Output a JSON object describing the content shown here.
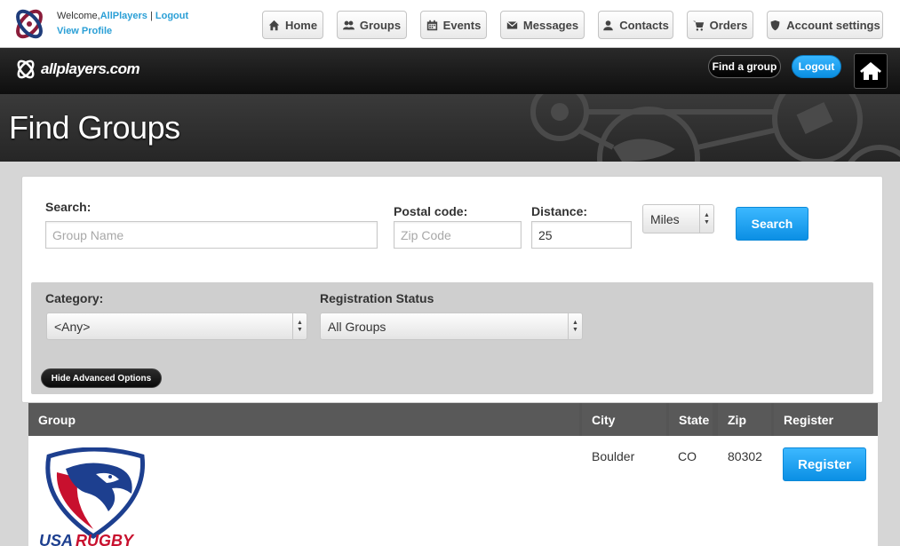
{
  "top": {
    "welcome_prefix": "Welcome,",
    "username": "AllPlayers",
    "separator": "|",
    "logout": "Logout",
    "view_profile": "View Profile"
  },
  "nav": {
    "home": "Home",
    "groups": "Groups",
    "events": "Events",
    "messages": "Messages",
    "contacts": "Contacts",
    "orders": "Orders",
    "account_settings": "Account settings"
  },
  "brandbar": {
    "brand": "allplayers.com",
    "find_group": "Find a group",
    "logout": "Logout"
  },
  "hero": {
    "title": "Find Groups"
  },
  "search": {
    "search_label": "Search:",
    "search_placeholder": "Group Name",
    "postal_label": "Postal code:",
    "postal_placeholder": "Zip Code",
    "distance_label": "Distance:",
    "distance_value": "25",
    "unit_selected": "Miles",
    "search_button": "Search"
  },
  "advanced": {
    "category_label": "Category:",
    "category_selected": "<Any>",
    "status_label": "Registration Status",
    "status_selected": "All Groups",
    "hide_button": "Hide Advanced Options"
  },
  "table": {
    "headers": [
      "Group",
      "City",
      "State",
      "Zip",
      "Register"
    ],
    "rows": [
      {
        "group_logo_text": "USA RUGBY",
        "city": "Boulder",
        "state": "CO",
        "zip": "80302",
        "register": "Register"
      }
    ]
  },
  "colors": {
    "link_blue": "#2a9fd6",
    "button_blue": "#0b8fe4",
    "header_gray": "#595959"
  }
}
